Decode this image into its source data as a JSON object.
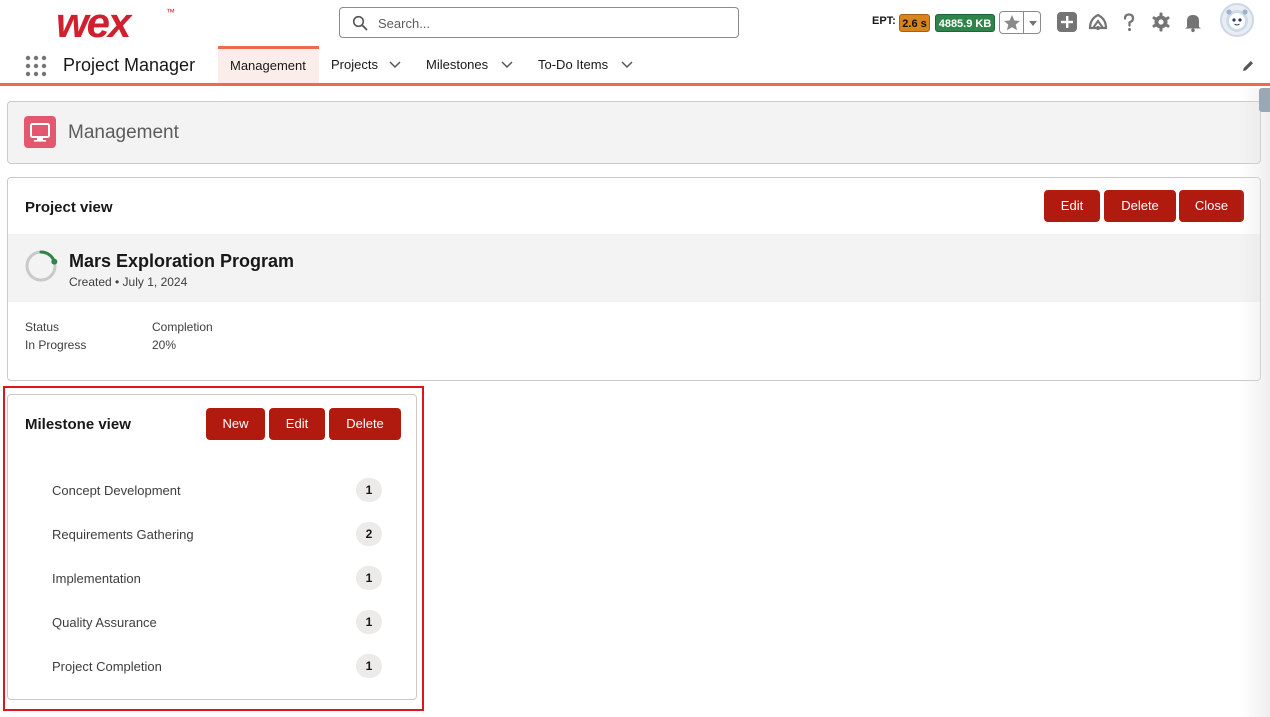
{
  "header": {
    "logo_text": "wex",
    "logo_mark": "™",
    "search": {
      "placeholder": "Search...",
      "value": ""
    },
    "ept_label": "EPT:",
    "ept_time": "2.6 s",
    "ept_size": "4885.9 KB",
    "icons": [
      "search-icon",
      "star-icon",
      "chevron-down-icon",
      "add-icon",
      "trailhead-icon",
      "help-icon",
      "gear-icon",
      "bell-icon",
      "avatar"
    ]
  },
  "nav": {
    "app_name": "Project Manager",
    "tabs": [
      {
        "label": "Management",
        "active": true
      },
      {
        "label": "Projects",
        "dropdown": true
      },
      {
        "label": "Milestones",
        "dropdown": true
      },
      {
        "label": "To-Do Items",
        "dropdown": true
      }
    ]
  },
  "page_header": {
    "title": "Management"
  },
  "project_card": {
    "title": "Project view",
    "buttons": {
      "edit": "Edit",
      "delete": "Delete",
      "close": "Close"
    },
    "record": {
      "name": "Mars Exploration Program",
      "meta": "Created • July 1, 2024",
      "progress_fraction": 0.2
    },
    "fields": [
      {
        "label": "Status",
        "value": "In Progress"
      },
      {
        "label": "Completion",
        "value": "20%"
      }
    ]
  },
  "milestone_card": {
    "title": "Milestone view",
    "buttons": {
      "new": "New",
      "edit": "Edit",
      "delete": "Delete"
    },
    "items": [
      {
        "label": "Concept Development",
        "count": "1"
      },
      {
        "label": "Requirements Gathering",
        "count": "2"
      },
      {
        "label": "Implementation",
        "count": "1"
      },
      {
        "label": "Quality Assurance",
        "count": "1"
      },
      {
        "label": "Project Completion",
        "count": "1"
      }
    ]
  },
  "colors": {
    "brand_red": "#d0202f",
    "button_red": "#b01a0f",
    "accent_orange": "#ee6a4d",
    "badge_orange": "#d8841e",
    "badge_green": "#2e844a",
    "page_icon_pink": "#e3586e",
    "progress_green": "#2e844a",
    "highlight_red": "#e0141e"
  }
}
